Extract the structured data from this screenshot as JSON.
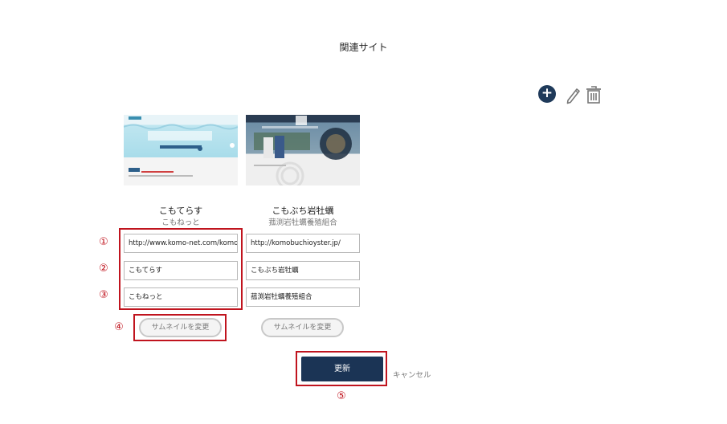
{
  "page": {
    "title": "関連サイト"
  },
  "toolbar": {
    "add_icon": "plus-circle-icon",
    "edit_icon": "pencil-icon",
    "delete_icon": "trash-icon"
  },
  "sites": [
    {
      "name": "こもてらす",
      "subtitle": "こもねっと",
      "url": "http://www.komo-net.com/komoterrace",
      "name_field": "こもてらす",
      "sub_field": "こもねっと",
      "thumb_button": "サムネイルを変更"
    },
    {
      "name": "こもぶち岩牡蠣",
      "subtitle": "菰渕岩牡蠣養殖組合",
      "url": "http://komobuchioyster.jp/",
      "name_field": "こもぶち岩牡蠣",
      "sub_field": "菰渕岩牡蠣養殖組合",
      "thumb_button": "サムネイルを変更"
    }
  ],
  "annotations": [
    "①",
    "②",
    "③",
    "④",
    "⑤"
  ],
  "actions": {
    "update": "更新",
    "cancel": "キャンセル"
  },
  "colors": {
    "primary": "#1b3455",
    "annotation_red": "#c0141e"
  }
}
